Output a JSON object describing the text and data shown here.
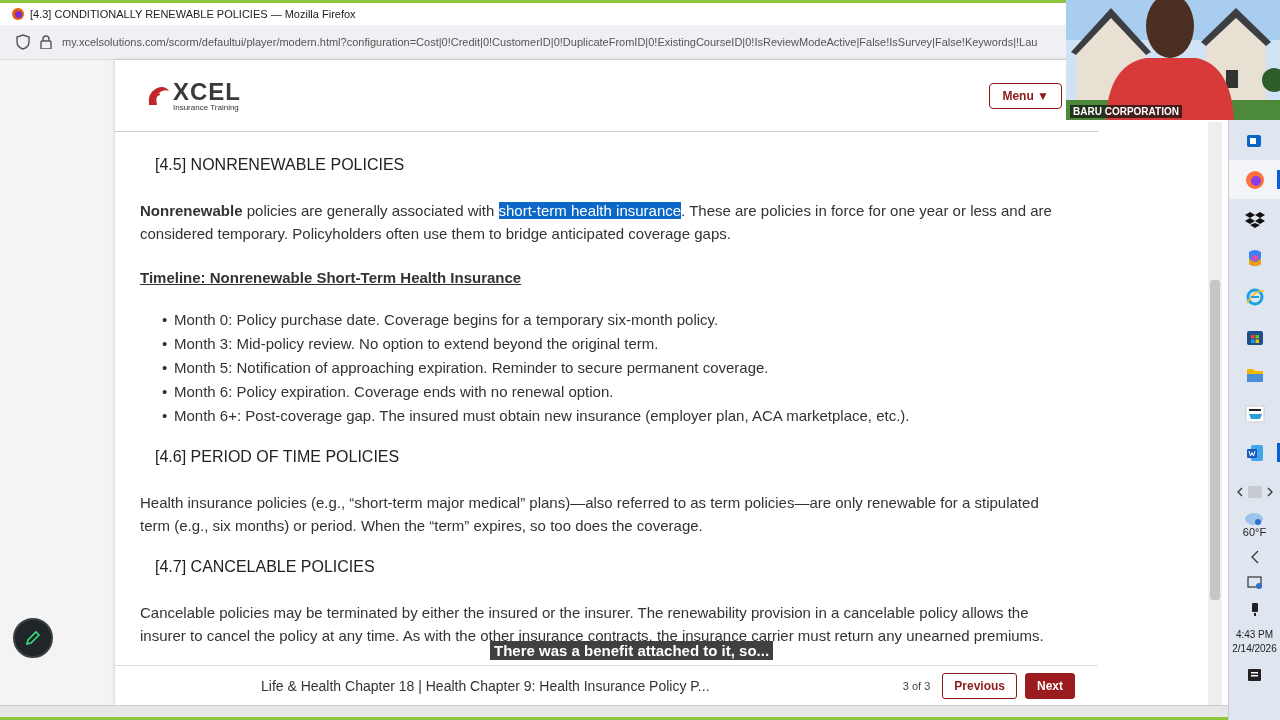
{
  "browser": {
    "title": "[4.3] CONDITIONALLY RENEWABLE POLICIES — Mozilla Firefox",
    "url": "my.xcelsolutions.com/scorm/defaultui/player/modern.html?configuration=Cost|0!Credit|0!CustomerID|0!DuplicateFromID|0!ExistingCourseID|0!IsReviewModeActive|False!IsSurvey|False!Keywords|!Lau"
  },
  "course": {
    "logo": {
      "name": "XCEL",
      "subtitle": "Insurance Training"
    },
    "menu_button": {
      "label": "Menu",
      "caret": "▼"
    },
    "content": [
      {
        "kind": "heading",
        "text": "[4.5] NONRENEWABLE POLICIES"
      },
      {
        "kind": "paragraph",
        "text": "**Nonrenewable** policies are generally associated with",
        "highlight": "short-term health insurance",
        "text_after": ". These are policies in force for one year or less and are considered temporary. Policyholders often use them to bridge anticipated coverage gaps."
      },
      {
        "kind": "subheading",
        "text": "Timeline: Nonrenewable Short-Term Health Insurance"
      },
      {
        "kind": "list",
        "marker": "•",
        "items": [
          "Month 0: Policy purchase date. Coverage begins for a temporary six-month policy.",
          "Month 3: Mid-policy review. No option to extend beyond the original term.",
          "Month 5: Notification of approaching expiration. Reminder to secure permanent coverage.",
          "Month 6: Policy expiration. Coverage ends with no renewal option.",
          "Month 6+: Post-coverage gap. The insured must obtain new insurance (employer plan, ACA marketplace, etc.)."
        ]
      },
      {
        "kind": "heading",
        "text": "[4.6] PERIOD OF TIME POLICIES"
      },
      {
        "kind": "paragraph",
        "text": "Health insurance policies (e.g., “short-term major medical” plans)—also referred to as term policies—are only renewable for a stipulated term (e.g., six months) or period. When the “term” expires, so too does the coverage."
      },
      {
        "kind": "heading",
        "text": "[4.7] CANCELABLE POLICIES"
      },
      {
        "kind": "paragraph",
        "text": "Cancelable policies may be terminated by either the insured or the insurer. The renewability provision in a cancelable policy allows the insurer to cancel the policy at any time. As with the other insurance contracts, the insurance carrier must return any unearned premiums."
      }
    ],
    "footer": {
      "title": "Life & Health Chapter 18 | Health Chapter 9: Health Insurance Policy P...",
      "page": "3 of 3",
      "buttons": [
        {
          "kind": "secondary",
          "label": "Previous"
        },
        {
          "kind": "primary",
          "label": "Next"
        }
      ]
    }
  },
  "caption": "There was a benefit attached to it, so...",
  "video": {
    "kind": "picture",
    "name": "BARU CORPORATION"
  },
  "taskbar": {
    "apps": [
      {
        "kind": "mail",
        "selected": false,
        "open": false
      },
      {
        "kind": "firefox",
        "selected": true,
        "open": true
      },
      {
        "kind": "dropbox",
        "selected": false,
        "open": false
      },
      {
        "kind": "copilot",
        "selected": false,
        "open": false
      },
      {
        "kind": "ie",
        "selected": false,
        "open": false
      },
      {
        "kind": "store",
        "selected": false,
        "open": false
      },
      {
        "kind": "folder",
        "selected": false,
        "open": false
      },
      {
        "kind": "cart",
        "selected": false,
        "open": false
      },
      {
        "kind": "word",
        "selected": false,
        "open": true
      }
    ],
    "weather": "60°F",
    "time": "4:43 PM",
    "date": "2/14/2026"
  }
}
